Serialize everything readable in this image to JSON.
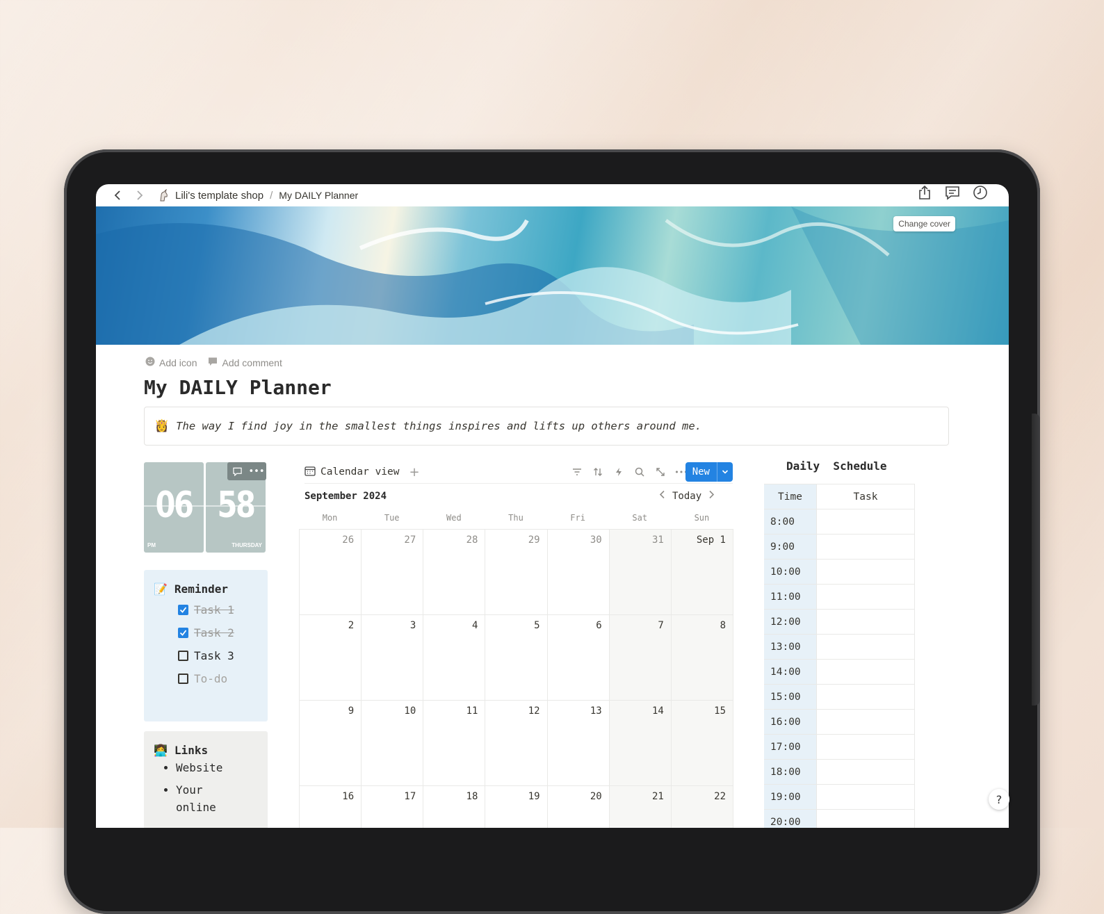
{
  "topbar": {
    "workspace_icon": "unicorn-icon",
    "workspace": "Lili's template shop",
    "separator": "/",
    "page": "My DAILY Planner"
  },
  "cover": {
    "change_label": "Change cover"
  },
  "page_meta": {
    "add_icon": "Add icon",
    "add_comment": "Add comment"
  },
  "title": "My DAILY Planner",
  "callout": {
    "icon": "👸",
    "text": "The way I find joy in the smallest things inspires and lifts up others around me."
  },
  "clock": {
    "hour": "06",
    "minute": "58",
    "ampm": "PM",
    "day": "THURSDAY"
  },
  "reminder": {
    "icon": "📝",
    "title": "Reminder",
    "items": [
      {
        "label": "Task 1",
        "checked": true
      },
      {
        "label": "Task 2",
        "checked": true
      },
      {
        "label": "Task 3",
        "checked": false
      },
      {
        "label": "To-do",
        "checked": false
      }
    ]
  },
  "links": {
    "icon": "👩‍💻",
    "title": "Links",
    "items": [
      "Website",
      "Your online"
    ]
  },
  "calendar": {
    "view_label": "Calendar view",
    "new_label": "New",
    "month": "September 2024",
    "today_label": "Today",
    "weekdays": [
      "Mon",
      "Tue",
      "Wed",
      "Thu",
      "Fri",
      "Sat",
      "Sun"
    ],
    "weeks": [
      [
        "26",
        "27",
        "28",
        "29",
        "30",
        "31",
        "Sep 1"
      ],
      [
        "2",
        "3",
        "4",
        "5",
        "6",
        "7",
        "8"
      ],
      [
        "9",
        "10",
        "11",
        "12",
        "13",
        "14",
        "15"
      ],
      [
        "16",
        "17",
        "18",
        "19",
        "20",
        "21",
        "22"
      ]
    ]
  },
  "schedule": {
    "title": "Daily  Schedule",
    "col_time": "Time",
    "col_task": "Task",
    "times": [
      "8:00",
      "9:00",
      "10:00",
      "11:00",
      "12:00",
      "13:00",
      "14:00",
      "15:00",
      "16:00",
      "17:00",
      "18:00",
      "19:00",
      "20:00"
    ]
  },
  "colors": {
    "accent": "#2383e2",
    "clock": "#b7c6c4",
    "reminder_bg": "#e7f1f8",
    "links_bg": "#efefed"
  }
}
